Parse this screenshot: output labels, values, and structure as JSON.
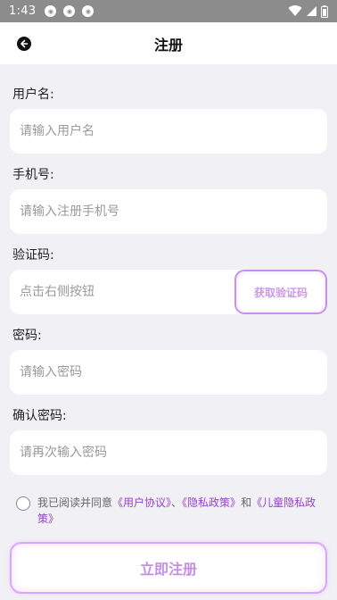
{
  "status_bar": {
    "time": "1:43",
    "notification_icons": [
      "notification-icon",
      "notification-icon",
      "notification-icon"
    ],
    "right_icons": [
      "wifi-icon",
      "signal-icon",
      "battery-icon"
    ]
  },
  "nav": {
    "title": "注册",
    "back_icon": "back-arrow-icon"
  },
  "form": {
    "username": {
      "label": "用户名:",
      "placeholder": "请输入用户名",
      "value": ""
    },
    "phone": {
      "label": "手机号:",
      "placeholder": "请输入注册手机号",
      "value": ""
    },
    "code": {
      "label": "验证码:",
      "placeholder": "点击右侧按钮",
      "value": "",
      "button_label": "获取验证码"
    },
    "password": {
      "label": "密码:",
      "placeholder": "请输入密码",
      "value": ""
    },
    "confirm_password": {
      "label": "确认密码:",
      "placeholder": "请再次输入密码",
      "value": ""
    }
  },
  "agreement": {
    "prefix": "我已阅读并同意",
    "user_agreement": "《用户协议》",
    "separator": "、",
    "privacy_policy": "《隐私政策》",
    "and": "和",
    "children_privacy": "《儿童隐私政策》",
    "checked": false
  },
  "submit": {
    "label": "立即注册"
  },
  "colors": {
    "background": "#f1f0f5",
    "status_bar": "#8c8c8c",
    "accent": "#9b3fd0",
    "button_border": "#d9a6ff"
  }
}
